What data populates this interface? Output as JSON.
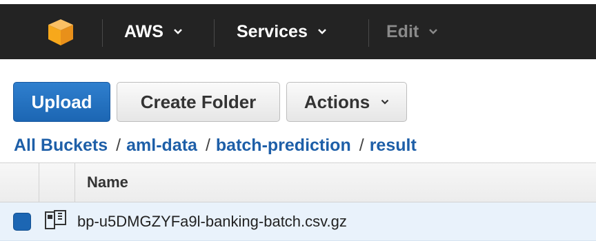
{
  "topnav": {
    "logo_icon": "aws-cube-icon",
    "aws_label": "AWS",
    "services_label": "Services",
    "edit_label": "Edit",
    "colors": {
      "bar": "#232323",
      "logo": "#f7a81b",
      "disabled": "#8a8a8a"
    }
  },
  "toolbar": {
    "upload_label": "Upload",
    "create_folder_label": "Create Folder",
    "actions_label": "Actions",
    "colors": {
      "primary": "#1c66b3"
    }
  },
  "breadcrumb": {
    "items": [
      "All Buckets",
      "aml-data",
      "batch-prediction",
      "result"
    ],
    "separator": "/",
    "color": "#1e5fa8"
  },
  "table": {
    "columns": {
      "name": "Name"
    },
    "rows": [
      {
        "name": "bp-u5DMGZYFa9l-banking-batch.csv.gz",
        "selected": true,
        "icon": "archive-file-icon"
      }
    ]
  }
}
